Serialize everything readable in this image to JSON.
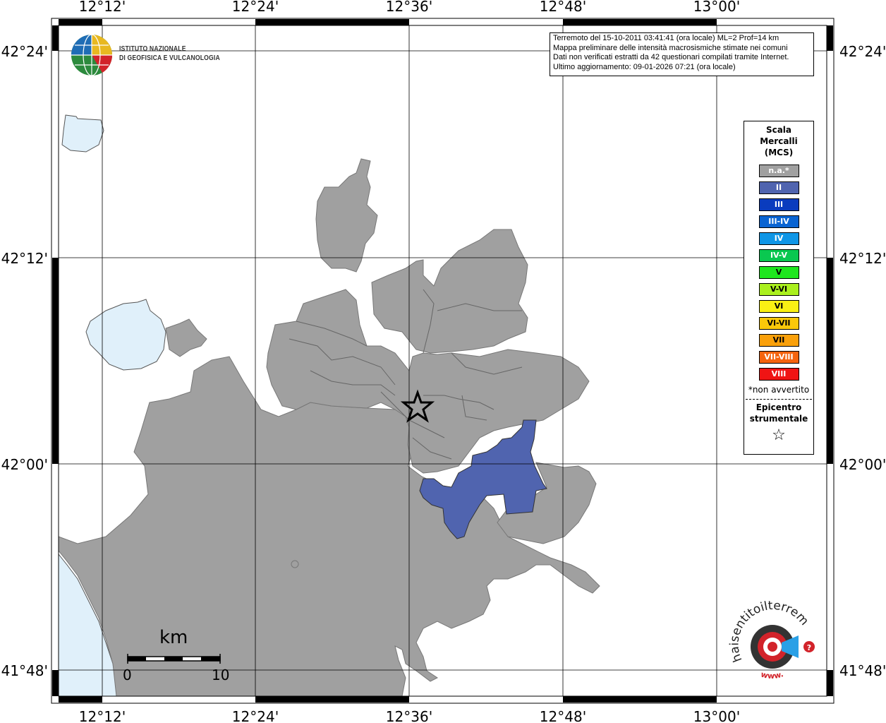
{
  "header": {
    "info_lines": [
      "Terremoto del 15-10-2011 03:41:41 (ora locale) ML=2 Prof=14 km",
      "Mappa preliminare delle intensità macrosismiche stimate nei comuni",
      "Dati non verificati estratti da 42 questionari compilati tramite Internet.",
      "Ultimo aggiornamento: 09-01-2026 07:21 (ora locale)"
    ]
  },
  "logo": {
    "line1": "ISTITUTO NAZIONALE",
    "line2": "DI GEOFISICA E VULCANOLOGIA",
    "icon": "ingv-globe-logo"
  },
  "axes": {
    "lon_labels": [
      "12°12'",
      "12°24'",
      "12°36'",
      "12°48'",
      "13°00'"
    ],
    "lat_labels": [
      "42°24'",
      "42°12'",
      "42°00'",
      "41°48'"
    ]
  },
  "legend": {
    "title_lines": [
      "Scala",
      "Mercalli",
      "(MCS)"
    ],
    "items": [
      {
        "label": "n.a.*",
        "color": "#a0a0a0"
      },
      {
        "label": "II",
        "color": "#5064af"
      },
      {
        "label": "III",
        "color": "#0a3cbe"
      },
      {
        "label": "III-IV",
        "color": "#0a64d2"
      },
      {
        "label": "IV",
        "color": "#0f96e6"
      },
      {
        "label": "IV-V",
        "color": "#0ac850"
      },
      {
        "label": "V",
        "color": "#1ee61e"
      },
      {
        "label": "V-VI",
        "color": "#aaf01e"
      },
      {
        "label": "VI",
        "color": "#faf014"
      },
      {
        "label": "VI-VII",
        "color": "#fac80a"
      },
      {
        "label": "VII",
        "color": "#faa00a"
      },
      {
        "label": "VII-VIII",
        "color": "#f5640f"
      },
      {
        "label": "VIII",
        "color": "#f01414"
      }
    ],
    "note": "*non avvertito",
    "epicenter_lines": [
      "Epicentro",
      "strumentale"
    ],
    "epicenter_symbol": "☆"
  },
  "scale_bar": {
    "unit": "km",
    "start": "0",
    "end": "10"
  },
  "colors": {
    "land": "#a0a0a0",
    "water": "#e0f0fa",
    "intensity_II": "#5064af",
    "frame": "#000000"
  },
  "watermark": {
    "text_arc": "haisentitoilterremoto.it",
    "text_url": "www.",
    "icon": "hai-sentito-il-terremoto-logo"
  }
}
